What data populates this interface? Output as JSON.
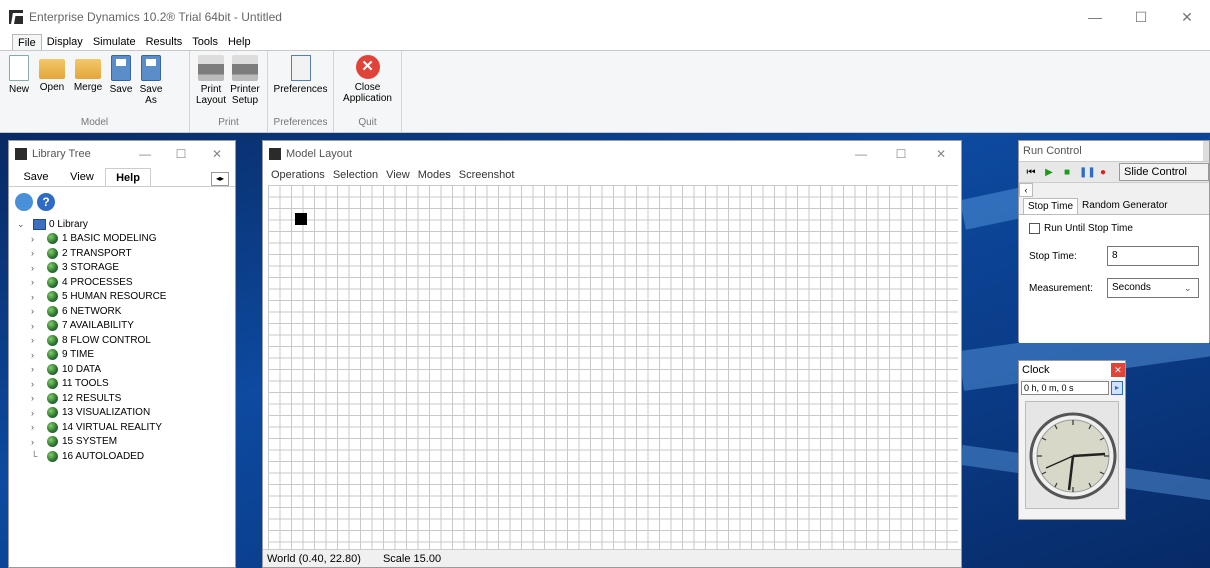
{
  "window": {
    "title": "Enterprise Dynamics 10.2® Trial 64bit - Untitled",
    "minimize": "—",
    "maximize": "☐",
    "close": "✕"
  },
  "menu": {
    "tabs": [
      "File",
      "Display",
      "Simulate",
      "Results",
      "Tools",
      "Help"
    ]
  },
  "ribbon": {
    "model": {
      "label": "Model",
      "buttons": [
        "New",
        "Open",
        "Merge",
        "Save",
        "Save As"
      ]
    },
    "print": {
      "label": "Print",
      "buttons": [
        "Print Layout",
        "Printer Setup"
      ]
    },
    "preferences": {
      "label": "Preferences",
      "buttons": [
        "Preferences"
      ]
    },
    "quit": {
      "label": "Quit",
      "buttons": [
        "Close Application"
      ]
    }
  },
  "library": {
    "title": "Library Tree",
    "tabs": [
      "Save",
      "View",
      "Help"
    ],
    "root": "0 Library",
    "items": [
      "1 BASIC MODELING",
      "2 TRANSPORT",
      "3 STORAGE",
      "4 PROCESSES",
      "5 HUMAN RESOURCE",
      "6 NETWORK",
      "7 AVAILABILITY",
      "8 FLOW CONTROL",
      "9 TIME",
      "10 DATA",
      "11 TOOLS",
      "12 RESULTS",
      "13 VISUALIZATION",
      "14 VIRTUAL REALITY",
      "15 SYSTEM",
      "16 AUTOLOADED"
    ]
  },
  "model_layout": {
    "title": "Model Layout",
    "menu": [
      "Operations",
      "Selection",
      "View",
      "Modes",
      "Screenshot"
    ],
    "status": {
      "world": "World (0.40, 22.80)",
      "scale": "Scale 15.00"
    }
  },
  "run_control": {
    "title": "Run Control",
    "slide_control": "Slide Control",
    "tabs": [
      "Stop Time",
      "Random Generator"
    ],
    "run_until_label": "Run Until Stop Time",
    "stop_time_label": "Stop Time:",
    "stop_time_value": "8",
    "measurement_label": "Measurement:",
    "measurement_value": "Seconds"
  },
  "clock": {
    "title": "Clock",
    "value": "0 h, 0 m, 0 s"
  },
  "colors": {
    "desktop": "#0d4aa0",
    "close_icon": "#e04438",
    "accent": "#2d6bc4"
  }
}
